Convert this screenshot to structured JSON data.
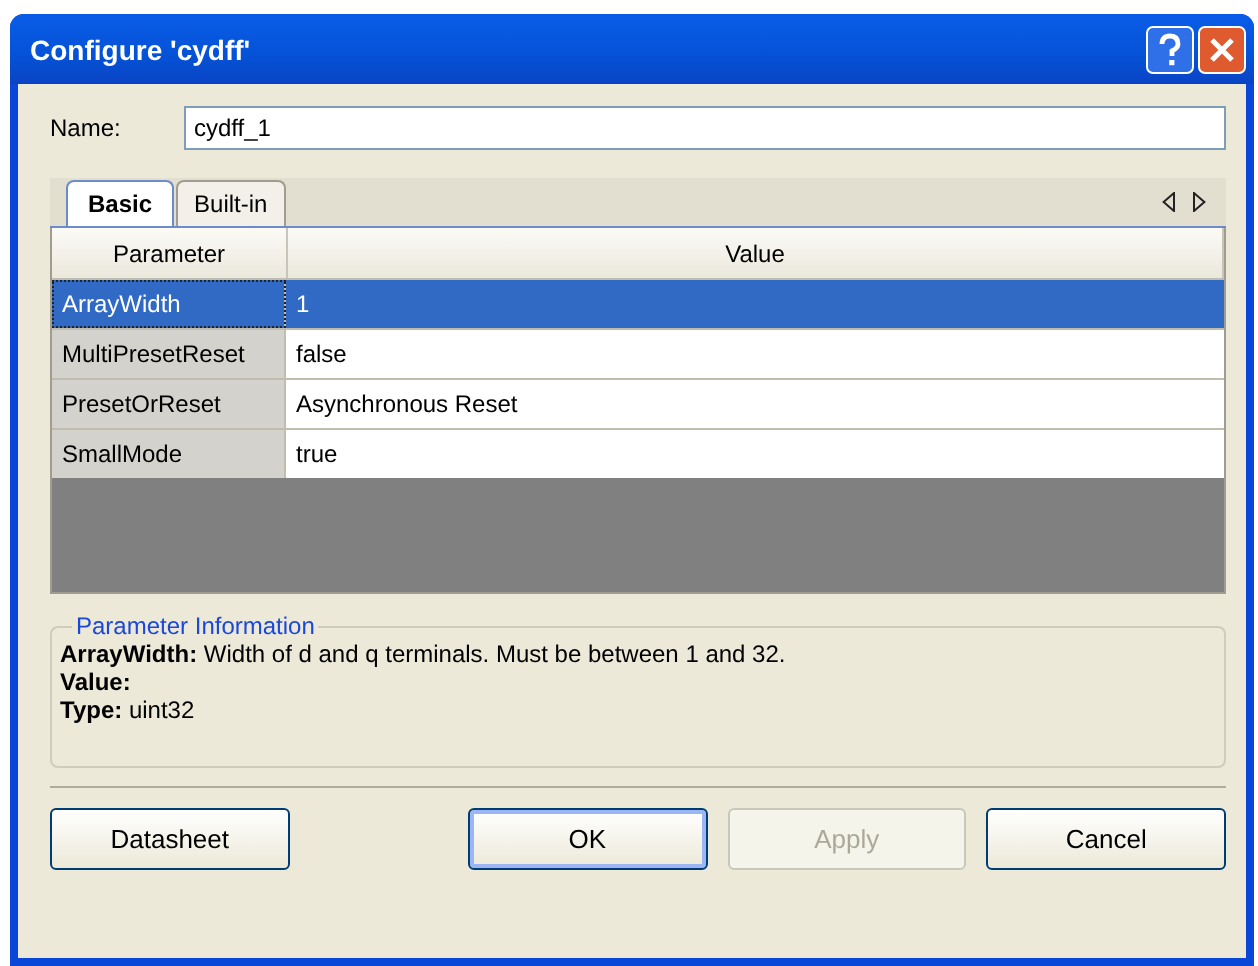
{
  "window": {
    "title": "Configure 'cydff'"
  },
  "name_field": {
    "label": "Name:",
    "value": "cydff_1"
  },
  "tabs": [
    {
      "label": "Basic",
      "selected": true
    },
    {
      "label": "Built-in",
      "selected": false
    }
  ],
  "table": {
    "columns": [
      "Parameter",
      "Value"
    ],
    "rows": [
      {
        "parameter": "ArrayWidth",
        "value": "1",
        "selected": true
      },
      {
        "parameter": "MultiPresetReset",
        "value": "false",
        "selected": false
      },
      {
        "parameter": "PresetOrReset",
        "value": "Asynchronous Reset",
        "selected": false
      },
      {
        "parameter": "SmallMode",
        "value": "true",
        "selected": false
      }
    ]
  },
  "parameter_information": {
    "title": "Parameter Information",
    "lines": [
      "**ArrayWidth:** Width of d and q terminals. Must be between 1 and 32.",
      "**Value:**",
      "**Type:** uint32"
    ]
  },
  "buttons": [
    {
      "label": "Datasheet",
      "disabled": false,
      "default": false
    },
    {
      "label": "OK",
      "disabled": false,
      "default": true
    },
    {
      "label": "Apply",
      "disabled": true,
      "default": false
    },
    {
      "label": "Cancel",
      "disabled": false,
      "default": false
    }
  ]
}
